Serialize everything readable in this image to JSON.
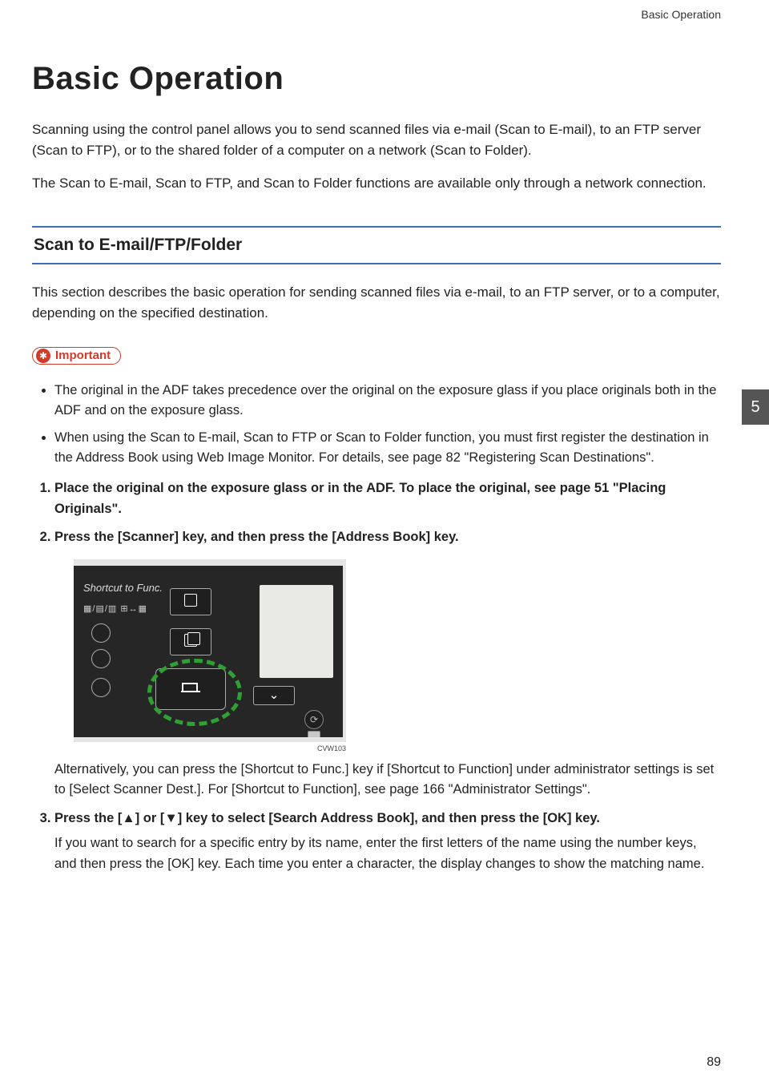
{
  "header": {
    "running": "Basic Operation"
  },
  "title": "Basic Operation",
  "intro": [
    "Scanning using the control panel allows you to send scanned files via e-mail (Scan to E-mail), to an FTP server (Scan to FTP), or to the shared folder of a computer on a network (Scan to Folder).",
    "The Scan to E-mail, Scan to FTP, and Scan to Folder functions are available only through a network connection."
  ],
  "section": {
    "heading": "Scan to E-mail/FTP/Folder",
    "lead": "This section describes the basic operation for sending scanned files via e-mail, to an FTP server, or to a computer, depending on the specified destination."
  },
  "important": {
    "label": "Important",
    "bullets": [
      "The original in the ADF takes precedence over the original on the exposure glass if you place originals both in the ADF and on the exposure glass.",
      "When using the Scan to E-mail, Scan to FTP or Scan to Folder function, you must first register the destination in the Address Book using Web Image Monitor. For details, see page 82 \"Registering Scan Destinations\"."
    ]
  },
  "steps": [
    {
      "head": "Place the original on the exposure glass or in the ADF. To place the original, see page 51 \"Placing Originals\"."
    },
    {
      "head": "Press the [Scanner] key, and then press the [Address Book] key.",
      "figure": {
        "shortcut_label": "Shortcut to Func.",
        "left_icons_text": "▦/▤/▥ ⊞↔▦",
        "caption": "CVW103"
      },
      "body": "Alternatively, you can press the [Shortcut to Func.] key if [Shortcut to Function] under administrator settings is set to [Select Scanner Dest.]. For [Shortcut to Function], see page 166 \"Administrator Settings\"."
    },
    {
      "head": "Press the [▲] or [▼] key to select [Search Address Book], and then press the [OK] key.",
      "body": "If you want to search for a specific entry by its name, enter the first letters of the name using the number keys, and then press the [OK] key. Each time you enter a character, the display changes to show the matching name."
    }
  ],
  "chapter_tab": "5",
  "page_number": "89",
  "glyphs": {
    "down_chevron": "⌄",
    "power": "⟳",
    "scan": "⬚"
  }
}
